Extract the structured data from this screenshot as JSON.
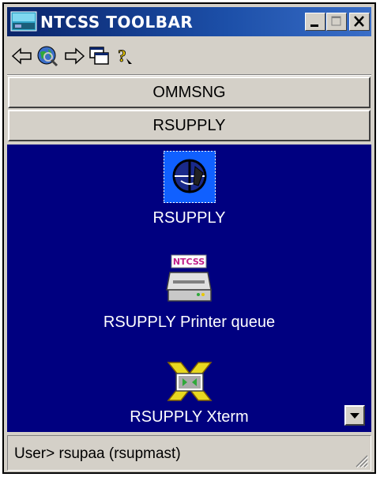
{
  "window": {
    "title": "NTCSS TOOLBAR",
    "controls": {
      "minimize": "minimize-icon",
      "maximize": "maximize-icon",
      "close": "close-icon"
    }
  },
  "toolbar": {
    "tools": [
      "back-arrow-icon",
      "globe-search-icon",
      "forward-arrow-icon",
      "windows-icon",
      "help-icon"
    ]
  },
  "groups": [
    {
      "label": "OMMSNG"
    },
    {
      "label": "RSUPPLY"
    }
  ],
  "apps": [
    {
      "label": "RSUPPLY",
      "icon": "rsupply-app-icon",
      "selected": true
    },
    {
      "label": "RSUPPLY Printer queue",
      "icon": "printer-queue-icon",
      "badge": "NTCSS"
    },
    {
      "label": "RSUPPLY Xterm",
      "icon": "xterm-icon"
    }
  ],
  "status": {
    "text": "User> rsupaa (rsupmast)"
  },
  "colors": {
    "titlebar": "#0a246a",
    "panel": "#000080",
    "chrome": "#d4d0c8",
    "selected": "#1060ff"
  }
}
